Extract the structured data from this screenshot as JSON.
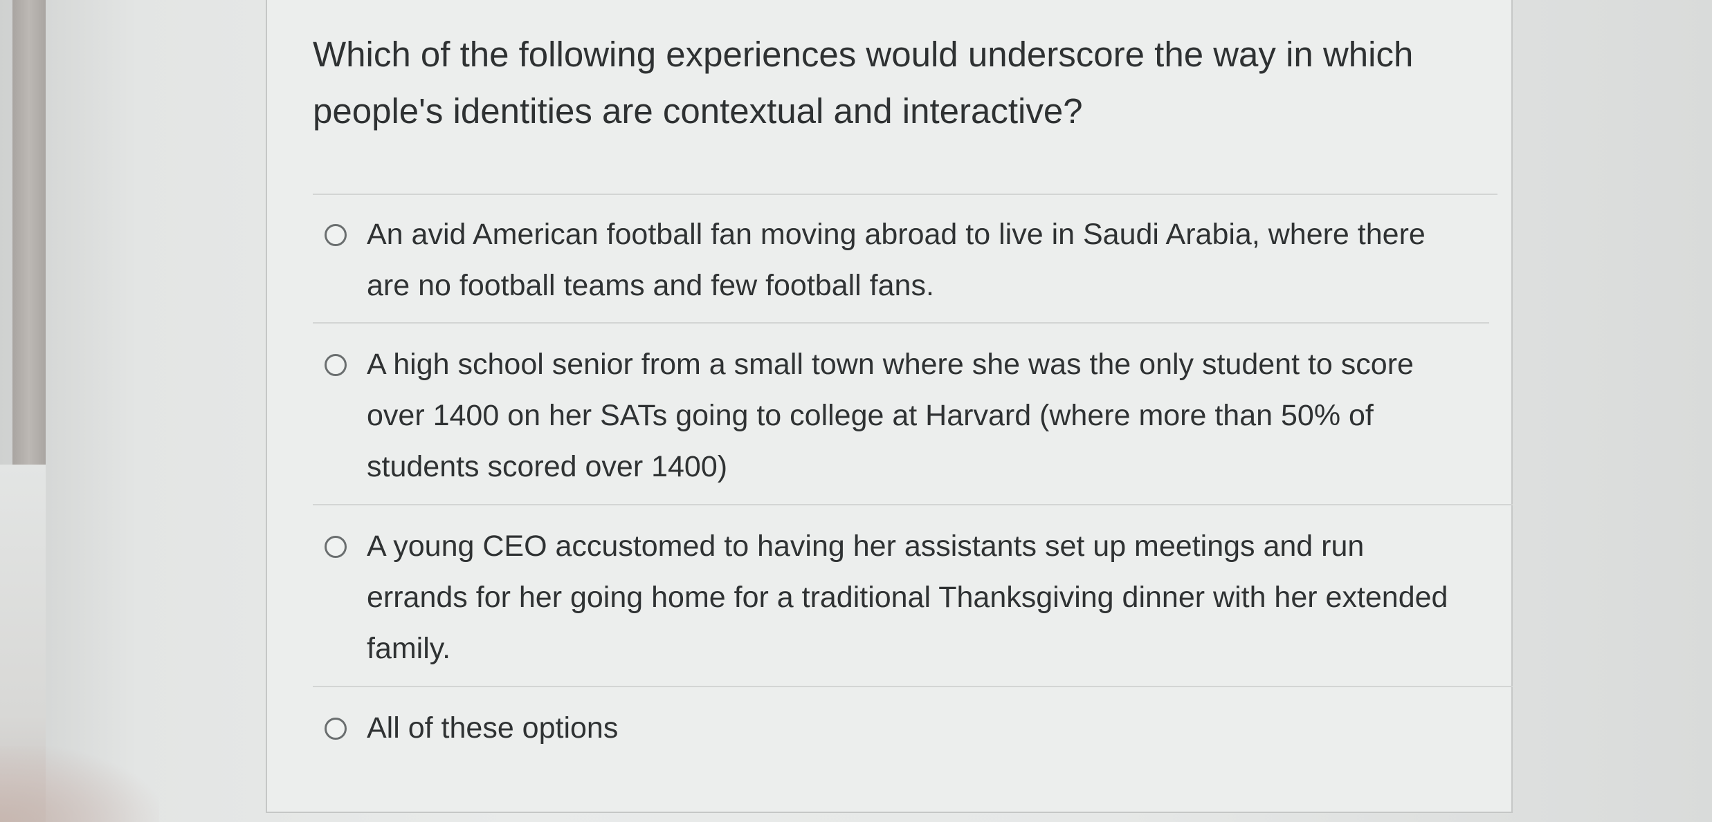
{
  "question": {
    "text": "Which of the following experiences would underscore the way in which people's identities are contextual and interactive?"
  },
  "options": [
    {
      "label": "An avid American football fan moving abroad to live in Saudi Arabia, where there are no football teams and few football fans.",
      "selected": false
    },
    {
      "label": "A high school senior from a small town where she was the only student to score over 1400 on her SATs going to college at Harvard (where more than 50% of students scored over 1400)",
      "selected": false
    },
    {
      "label": "A young CEO accustomed to having her assistants set up meetings and run errands for her going home for a traditional Thanksgiving dinner with her extended family.",
      "selected": false
    },
    {
      "label": "All of these options",
      "selected": false
    }
  ]
}
